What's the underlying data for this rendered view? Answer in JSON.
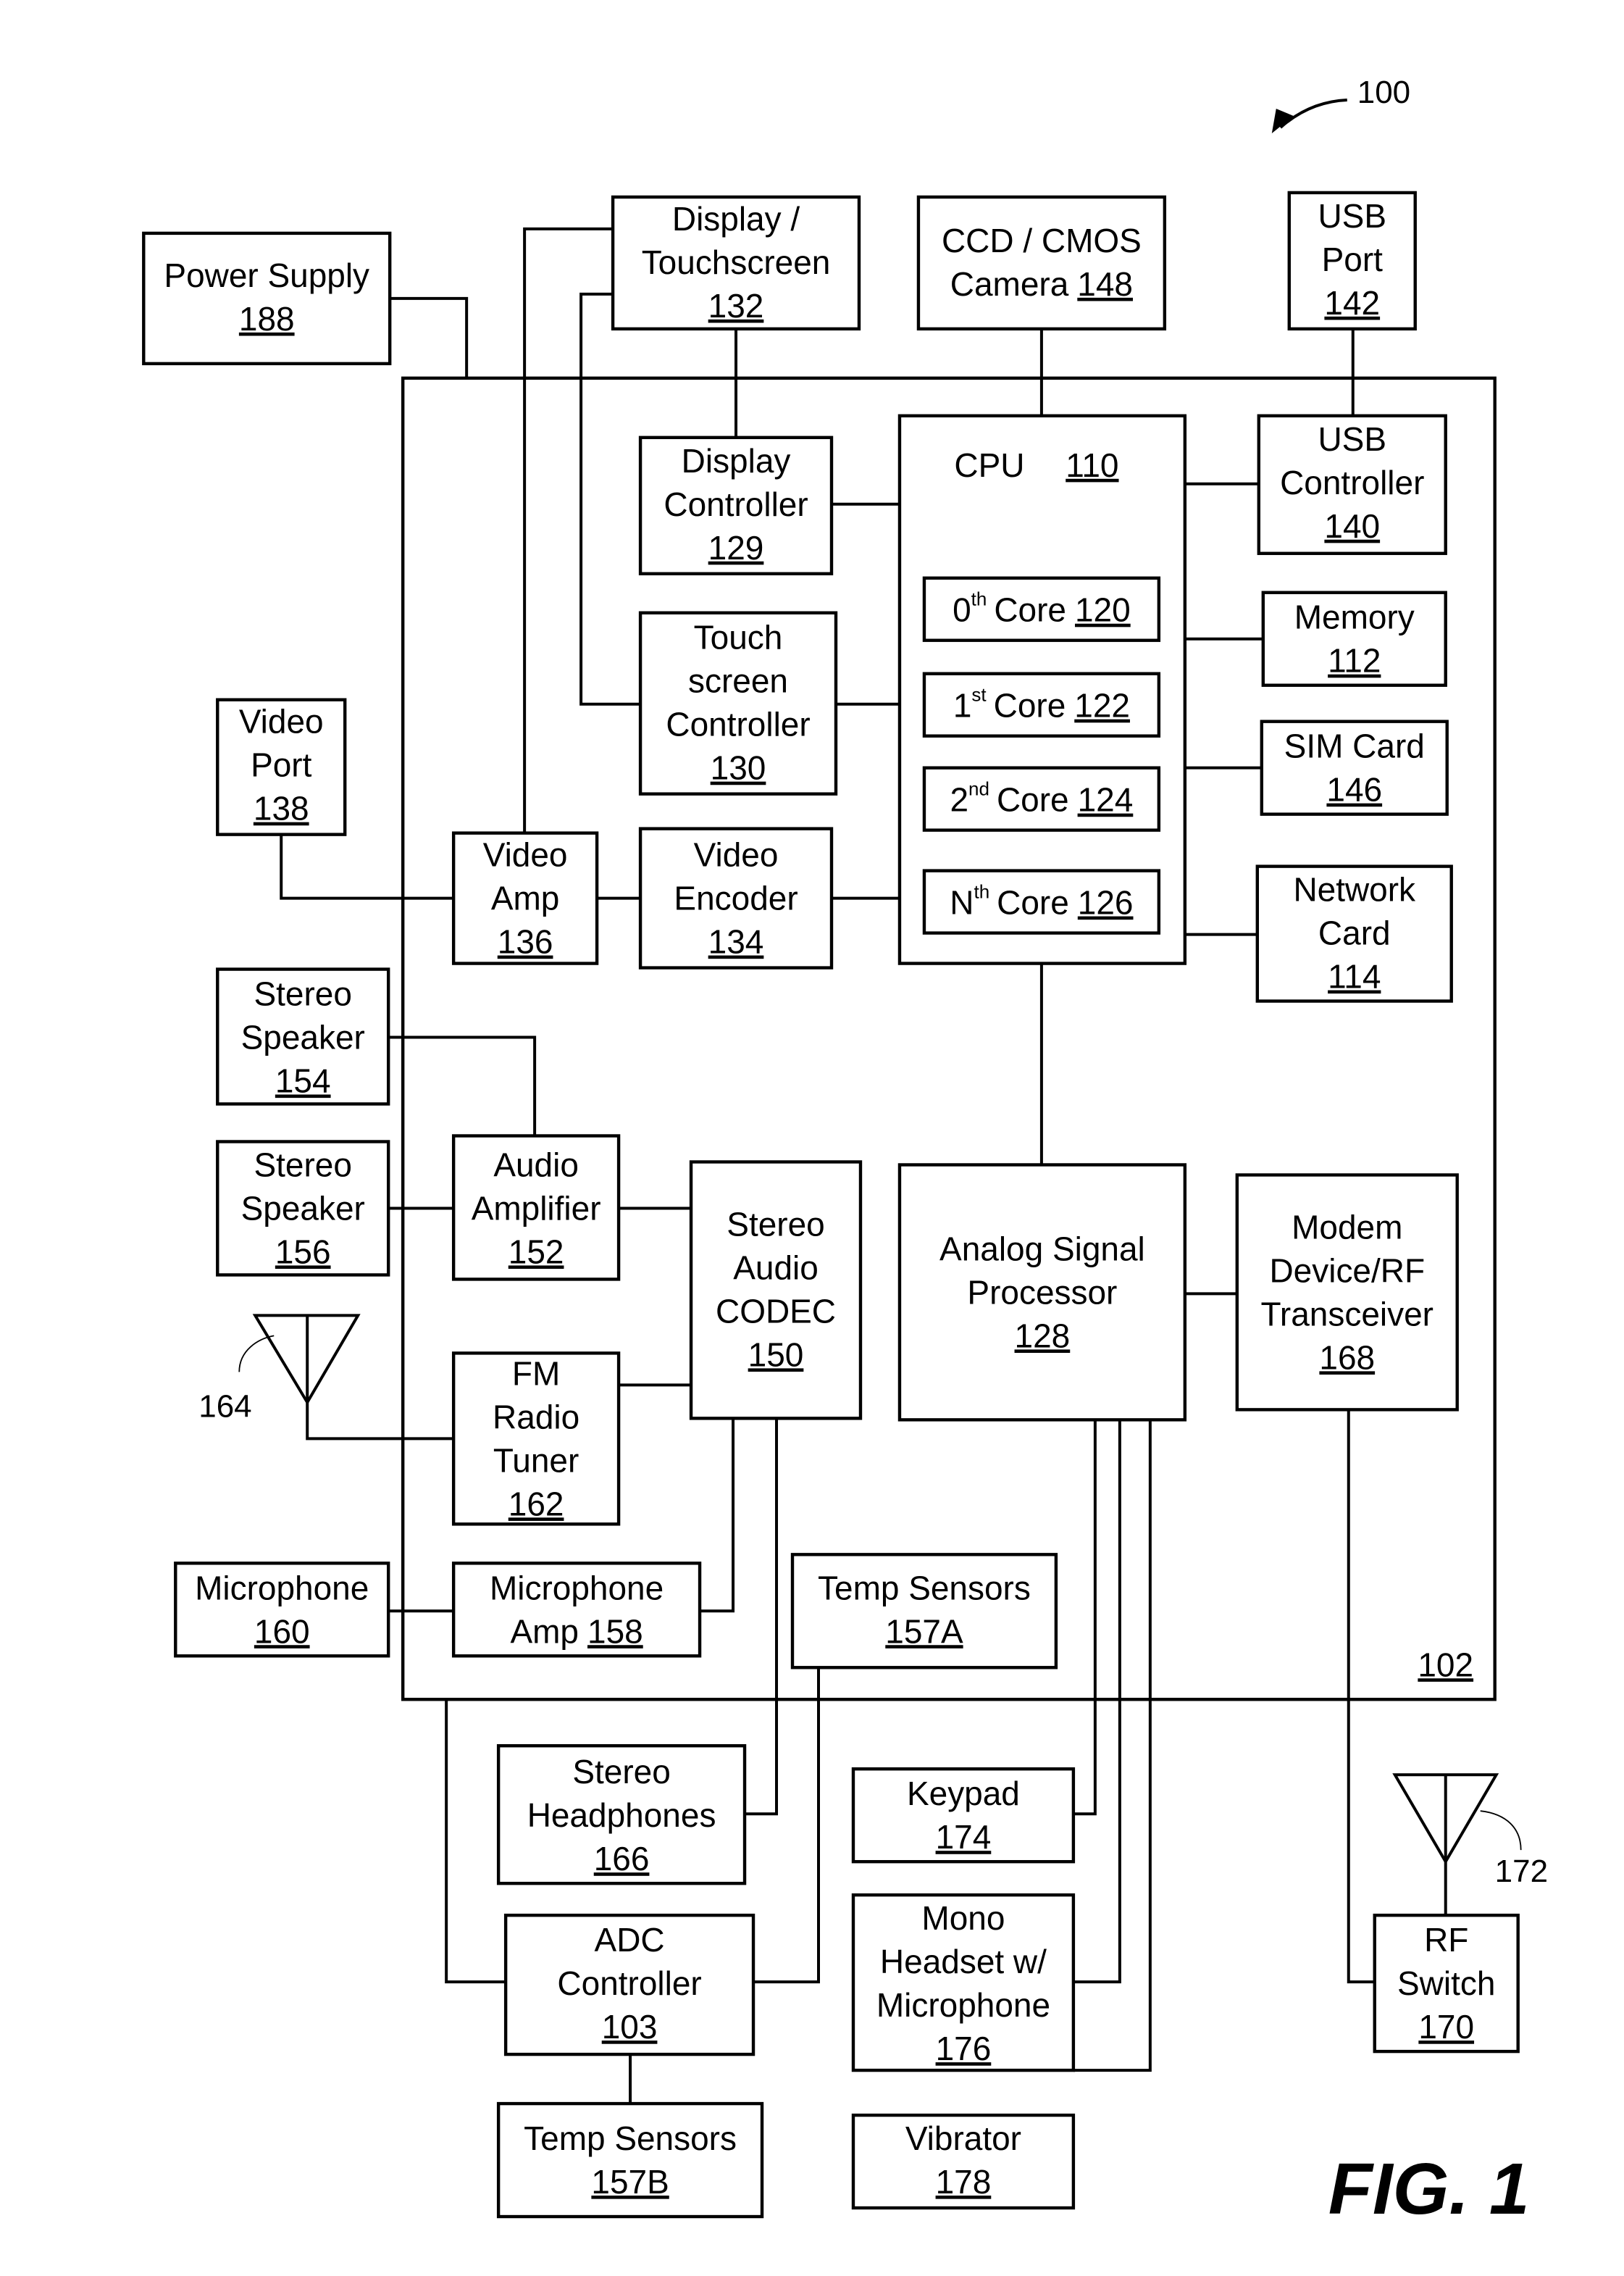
{
  "figure": {
    "label": "FIG. 1",
    "device_ref": "100",
    "chip_ref": "102"
  },
  "blocks": {
    "power_supply": {
      "lines": [
        "Power Supply"
      ],
      "ref": "188"
    },
    "display": {
      "lines": [
        "Display /",
        "Touchscreen"
      ],
      "ref": "132"
    },
    "camera": {
      "lines": [
        "CCD / CMOS",
        "Camera"
      ],
      "ref": "148"
    },
    "usb_port": {
      "lines": [
        "USB",
        "Port"
      ],
      "ref": "142"
    },
    "display_controller": {
      "lines": [
        "Display",
        "Controller"
      ],
      "ref": "129"
    },
    "touch_controller": {
      "lines": [
        "Touch",
        "screen",
        "Controller"
      ],
      "ref": "130"
    },
    "cpu": {
      "lines": [
        "CPU"
      ],
      "ref": "110"
    },
    "usb_controller": {
      "lines": [
        "USB",
        "Controller"
      ],
      "ref": "140"
    },
    "memory": {
      "lines": [
        "Memory"
      ],
      "ref": "112"
    },
    "sim_card": {
      "lines": [
        "SIM Card"
      ],
      "ref": "146"
    },
    "network_card": {
      "lines": [
        "Network",
        "Card"
      ],
      "ref": "114"
    },
    "video_port": {
      "lines": [
        "Video",
        "Port"
      ],
      "ref": "138"
    },
    "video_amp": {
      "lines": [
        "Video",
        "Amp"
      ],
      "ref": "136"
    },
    "video_encoder": {
      "lines": [
        "Video",
        "Encoder"
      ],
      "ref": "134"
    },
    "stereo_speaker_1": {
      "lines": [
        "Stereo",
        "Speaker"
      ],
      "ref": "154"
    },
    "stereo_speaker_2": {
      "lines": [
        "Stereo",
        "Speaker"
      ],
      "ref": "156"
    },
    "audio_amplifier": {
      "lines": [
        "Audio",
        "Amplifier"
      ],
      "ref": "152"
    },
    "stereo_codec": {
      "lines": [
        "Stereo",
        "Audio",
        "CODEC"
      ],
      "ref": "150"
    },
    "analog_signal_processor": {
      "lines": [
        "Analog Signal",
        "Processor"
      ],
      "ref": "128"
    },
    "modem": {
      "lines": [
        "Modem",
        "Device/RF",
        "Transceiver"
      ],
      "ref": "168"
    },
    "fm_tuner": {
      "lines": [
        "FM",
        "Radio",
        "Tuner"
      ],
      "ref": "162"
    },
    "microphone": {
      "lines": [
        "Microphone"
      ],
      "ref": "160"
    },
    "microphone_amp": {
      "lines": [
        "Microphone",
        "Amp"
      ],
      "ref": "158"
    },
    "temp_sensors_a": {
      "lines": [
        "Temp Sensors"
      ],
      "ref": "157A"
    },
    "stereo_headphones": {
      "lines": [
        "Stereo",
        "Headphones"
      ],
      "ref": "166"
    },
    "keypad": {
      "lines": [
        "Keypad"
      ],
      "ref": "174"
    },
    "adc_controller": {
      "lines": [
        "ADC",
        "Controller"
      ],
      "ref": "103"
    },
    "mono_headset": {
      "lines": [
        "Mono",
        "Headset w/",
        "Microphone"
      ],
      "ref": "176"
    },
    "rf_switch": {
      "lines": [
        "RF",
        "Switch"
      ],
      "ref": "170"
    },
    "temp_sensors_b": {
      "lines": [
        "Temp Sensors"
      ],
      "ref": "157B"
    },
    "vibrator": {
      "lines": [
        "Vibrator"
      ],
      "ref": "178"
    }
  },
  "cores": [
    {
      "num": "0",
      "suffix": "th",
      "word": "Core",
      "ref": "120"
    },
    {
      "num": "1",
      "suffix": "st",
      "word": "Core",
      "ref": "122"
    },
    {
      "num": "2",
      "suffix": "nd",
      "word": "Core",
      "ref": "124"
    },
    {
      "num": "N",
      "suffix": "th",
      "word": "Core",
      "ref": "126"
    }
  ],
  "antennas": {
    "fm_antenna_ref": "164",
    "rf_antenna_ref": "172"
  }
}
